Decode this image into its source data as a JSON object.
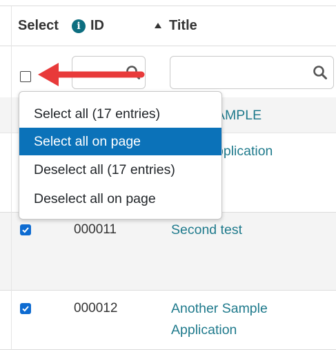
{
  "header": {
    "select_label": "Select",
    "info_icon_glyph": "i",
    "id_label": "ID",
    "title_label": "Title"
  },
  "dropdown": {
    "items": [
      {
        "label": "Select all (17 entries)"
      },
      {
        "label": "Select all on page",
        "active": true
      },
      {
        "label": "Deselect all (17 entries)"
      },
      {
        "label": "Deselect all on page"
      }
    ]
  },
  "rows": [
    {
      "title_partial": "SAMPLE"
    },
    {
      "title_partial": "Application"
    },
    {
      "id": "000011",
      "title": "Second test",
      "checked": true
    },
    {
      "id": "000012",
      "title": [
        "Another Sample",
        "Application"
      ],
      "checked": true
    }
  ],
  "colors": {
    "link": "#1f7a8c",
    "active_item": "#0b72b9",
    "checkbox": "#0d6bd1",
    "arrow": "#e83a3a",
    "info_icon": "#0d6e80"
  },
  "icons": {
    "search": "search-icon",
    "info": "info-icon",
    "sort": "sort-ascending-icon",
    "arrow": "red-arrow-annotation"
  }
}
